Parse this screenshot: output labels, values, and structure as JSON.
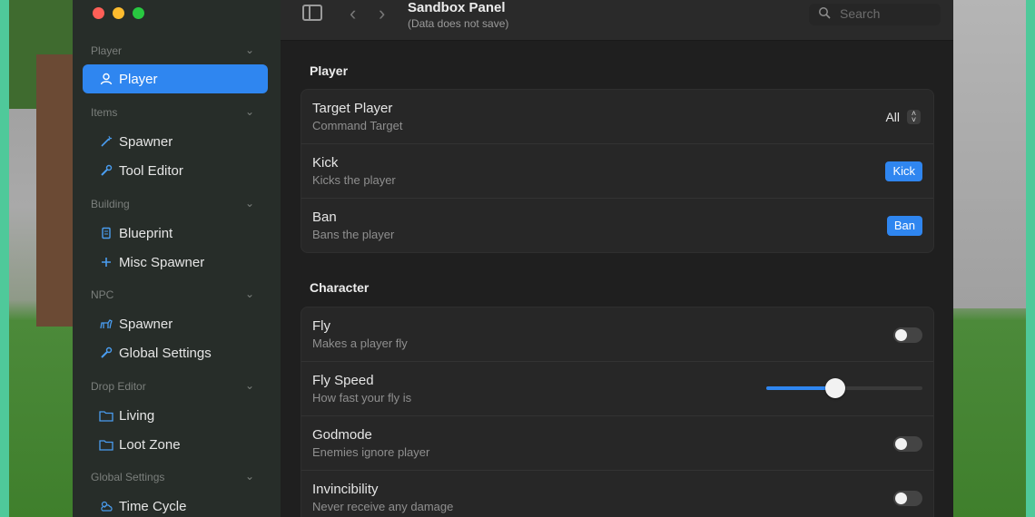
{
  "window": {
    "title": "Sandbox Panel",
    "subtitle": "(Data does not save)"
  },
  "search": {
    "placeholder": "Search"
  },
  "sidebar": {
    "sections": [
      {
        "header": "Player",
        "items": [
          {
            "label": "Player",
            "icon": "person-icon",
            "active": true
          }
        ]
      },
      {
        "header": "Items",
        "items": [
          {
            "label": "Spawner",
            "icon": "wand-icon"
          },
          {
            "label": "Tool Editor",
            "icon": "wrench-icon"
          }
        ]
      },
      {
        "header": "Building",
        "items": [
          {
            "label": "Blueprint",
            "icon": "scroll-icon"
          },
          {
            "label": "Misc Spawner",
            "icon": "plus-icon"
          }
        ]
      },
      {
        "header": "NPC",
        "items": [
          {
            "label": "Spawner",
            "icon": "dog-icon"
          },
          {
            "label": "Global Settings",
            "icon": "wrench-icon"
          }
        ]
      },
      {
        "header": "Drop Editor",
        "items": [
          {
            "label": "Living",
            "icon": "folder-icon"
          },
          {
            "label": "Loot Zone",
            "icon": "folder-icon"
          }
        ]
      },
      {
        "header": "Global Settings",
        "items": [
          {
            "label": "Time Cycle",
            "icon": "cloud-sun-icon"
          }
        ]
      }
    ]
  },
  "player_section": {
    "title": "Player",
    "target": {
      "title": "Target Player",
      "desc": "Command Target",
      "value": "All"
    },
    "kick": {
      "title": "Kick",
      "desc": "Kicks the player",
      "button": "Kick"
    },
    "ban": {
      "title": "Ban",
      "desc": "Bans the player",
      "button": "Ban"
    }
  },
  "character_section": {
    "title": "Character",
    "fly": {
      "title": "Fly",
      "desc": "Makes a player fly",
      "on": false
    },
    "fly_speed": {
      "title": "Fly Speed",
      "desc": "How fast your fly is",
      "value_fraction": 0.44
    },
    "godmode": {
      "title": "Godmode",
      "desc": "Enemies ignore player",
      "on": false
    },
    "invincibility": {
      "title": "Invincibility",
      "desc": "Never receive any damage",
      "on": false
    }
  },
  "colors": {
    "accent": "#2f86f0",
    "window_bg": "#1f1f1f",
    "sidebar_bg": "#282e2a",
    "frame": "#4fc99a"
  }
}
